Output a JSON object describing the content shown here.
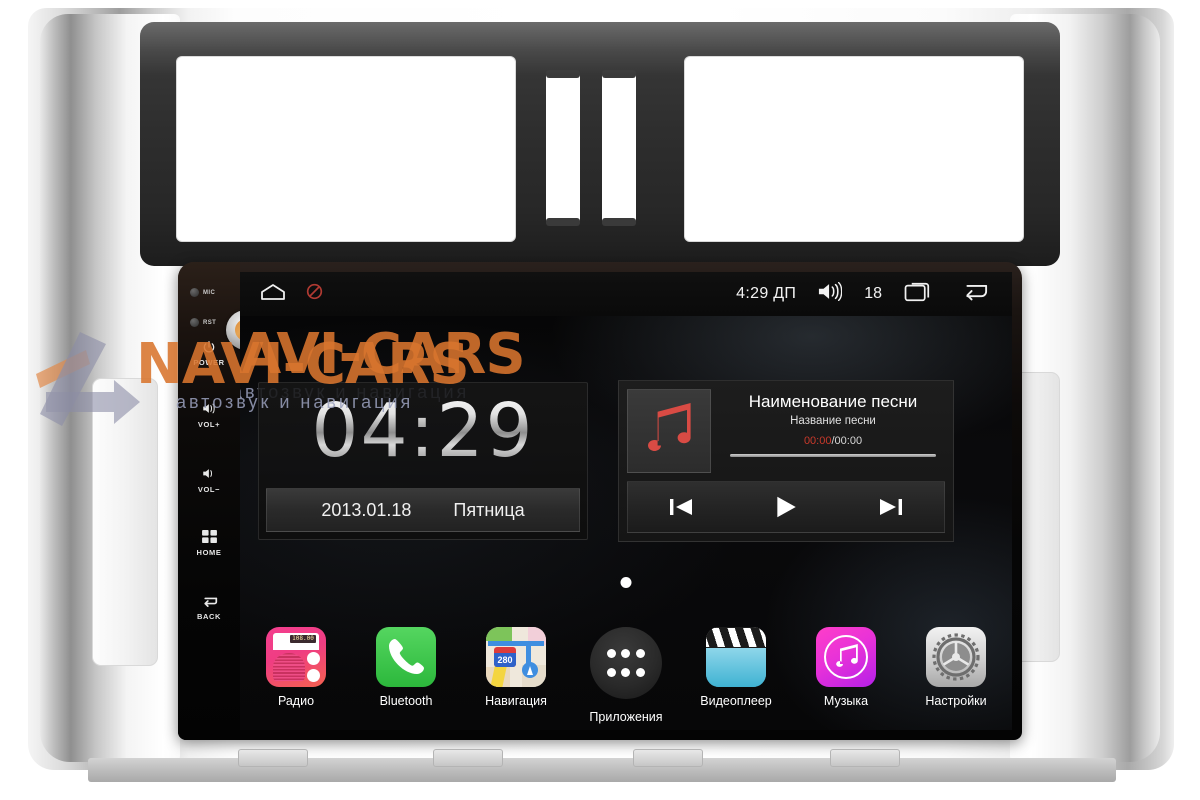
{
  "device": {
    "name": "android-car-head-unit",
    "brand_watermark": "NAVI-CARS",
    "brand_tagline": "автозвук и навигация"
  },
  "hardware_keys": {
    "mic_label": "MIC",
    "reset_label": "RST",
    "buttons": [
      {
        "name": "power",
        "label": "POWER",
        "glyph": "⏻"
      },
      {
        "name": "volume-up",
        "label": "VOL+",
        "glyph": "volume-icon"
      },
      {
        "name": "volume-down",
        "label": "VOL−",
        "glyph": "volume-icon"
      },
      {
        "name": "home",
        "label": "HOME",
        "glyph": "grid-icon"
      },
      {
        "name": "back",
        "label": "BACK",
        "glyph": "back-arrow-icon"
      }
    ]
  },
  "statusbar": {
    "home_icon": "home-icon",
    "block_icon": "no-entry-icon",
    "time": "4:29 ДП",
    "volume_icon": "volume-icon",
    "volume_level": "18",
    "recents_icon": "recent-apps-icon",
    "back_icon": "back-icon"
  },
  "clock_widget": {
    "time": "04:29",
    "date": "2013.01.18",
    "weekday": "Пятница"
  },
  "music_widget": {
    "album_art_icon": "music-note-icon",
    "track_title": "Наименование песни",
    "track_subtitle": "Название песни",
    "time_current": "00:00",
    "time_separator": "/",
    "time_total": "00:00",
    "progress_percent": 0,
    "controls": [
      {
        "name": "previous-track",
        "glyph": "⏮"
      },
      {
        "name": "play",
        "glyph": "▶"
      },
      {
        "name": "next-track",
        "glyph": "⏭"
      }
    ]
  },
  "home": {
    "page_indicator_dots": 1,
    "dock": [
      {
        "name": "radio",
        "label": "Радио",
        "icon": "radio-icon",
        "display": "108.00"
      },
      {
        "name": "bluetooth",
        "label": "Bluetooth",
        "icon": "phone-icon"
      },
      {
        "name": "navigation",
        "label": "Навигация",
        "icon": "map-icon",
        "display": "280"
      },
      {
        "name": "apps",
        "label": "Приложения",
        "icon": "app-drawer-icon"
      },
      {
        "name": "video",
        "label": "Видеоплеер",
        "icon": "clapperboard-icon"
      },
      {
        "name": "music",
        "label": "Музыка",
        "icon": "music-note-icon"
      },
      {
        "name": "settings",
        "label": "Настройки",
        "icon": "gear-icon"
      }
    ]
  },
  "colors": {
    "accent_orange": "#d9752e",
    "accent_red": "#c9392b",
    "radio_pink": "#f43f8f",
    "bluetooth_green": "#2cb83c",
    "music_magenta": "#e832d8",
    "video_blue": "#45b4d4"
  }
}
